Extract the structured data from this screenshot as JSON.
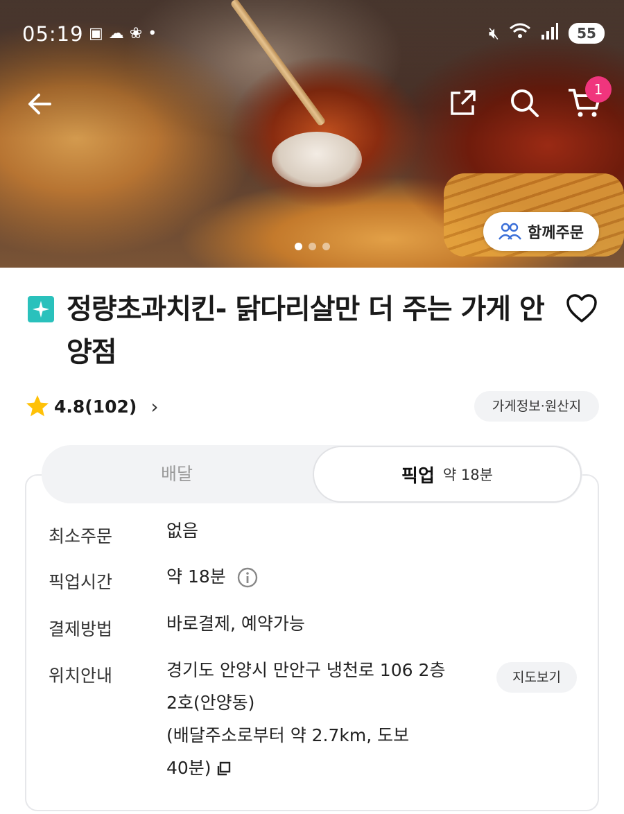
{
  "status_bar": {
    "time": "05:19",
    "battery": "55",
    "left_icons": [
      "screenshot-icon",
      "weather-icon",
      "paw-icon",
      "dot-icon"
    ],
    "right_icons": [
      "mute-icon",
      "wifi-icon",
      "signal-icon",
      "battery-icon"
    ]
  },
  "nav": {
    "cart_count": "1",
    "group_order_label": "함께주문"
  },
  "carousel": {
    "count": 3,
    "active": 1
  },
  "store": {
    "name": "정량초과치킨- 닭다리살만 더 주는 가게 안양점",
    "rating": "4.8(102)",
    "info_chip": "가게정보·원산지"
  },
  "tabs": {
    "delivery": "배달",
    "pickup": "픽업",
    "pickup_eta": "약 18분"
  },
  "details": [
    {
      "label": "최소주문",
      "value": "없음"
    },
    {
      "label": "픽업시간",
      "value": "약 18분"
    },
    {
      "label": "결제방법",
      "value": "바로결제, 예약가능"
    },
    {
      "label": "위치안내",
      "address_line1": "경기도 안양시 만안구 냉천로 106 2층",
      "address_line2": "2호(안양동)",
      "distance_line1": "(배달주소로부터 약 2.7km, 도보",
      "distance_line2": "40분)"
    }
  ],
  "map_button": "지도보기",
  "colors": {
    "brand_teal": "#2ac1bc",
    "badge_pink": "#f0357d",
    "star": "#ffc107",
    "chip_bg": "#f2f3f5"
  }
}
